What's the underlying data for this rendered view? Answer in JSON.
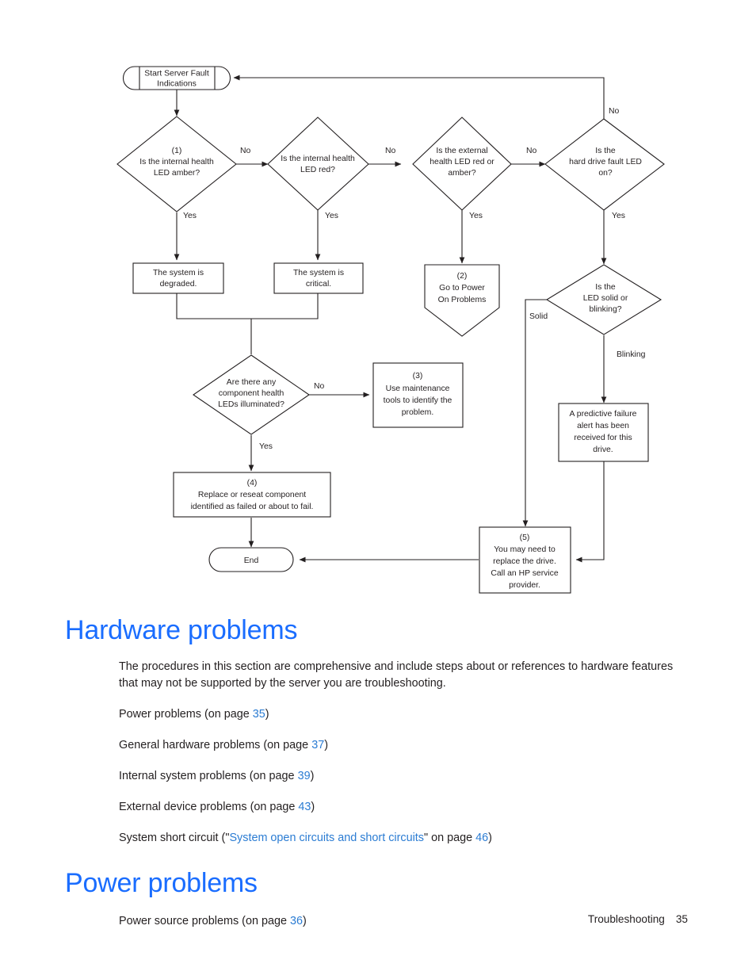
{
  "flowchart": {
    "title": "Server Fault Indications troubleshooting flowchart",
    "nodes": {
      "start": {
        "id": "start",
        "shape": "terminator",
        "text": [
          "Start Server Fault",
          "Indications"
        ]
      },
      "d1": {
        "id": "d1",
        "shape": "decision",
        "text": [
          "(1)",
          "Is the internal health",
          "LED amber?"
        ]
      },
      "d2": {
        "id": "d2",
        "shape": "decision",
        "text": [
          "Is the internal health",
          "LED red?"
        ]
      },
      "d3": {
        "id": "d3",
        "shape": "decision",
        "text": [
          "Is the external",
          "health LED red or",
          "amber?"
        ]
      },
      "d4": {
        "id": "d4",
        "shape": "decision",
        "text": [
          "Is the",
          "hard drive fault LED",
          "on?"
        ]
      },
      "d5": {
        "id": "d5",
        "shape": "decision",
        "text": [
          "Is the",
          "LED solid or",
          "blinking?"
        ]
      },
      "d6": {
        "id": "d6",
        "shape": "decision",
        "text": [
          "Are there any",
          "component health",
          "LEDs illuminated?"
        ]
      },
      "p1": {
        "id": "p1",
        "shape": "process",
        "text": [
          "The system is",
          "degraded."
        ]
      },
      "p2": {
        "id": "p2",
        "shape": "process",
        "text": [
          "The system is",
          "critical."
        ]
      },
      "p3": {
        "id": "p3",
        "shape": "pentagon",
        "text": [
          "(2)",
          "Go to Power",
          "On Problems"
        ]
      },
      "p4": {
        "id": "p4",
        "shape": "process",
        "text": [
          "(3)",
          "Use maintenance",
          "tools to identify the",
          "problem."
        ]
      },
      "p5": {
        "id": "p5",
        "shape": "process",
        "text": [
          "(4)",
          "Replace or reseat component",
          "identified as failed or about to fail."
        ]
      },
      "p6": {
        "id": "p6",
        "shape": "process",
        "text": [
          "A predictive failure",
          "alert has been",
          "received for this",
          "drive."
        ]
      },
      "p7": {
        "id": "p7",
        "shape": "process",
        "text": [
          "(5)",
          "You may need to",
          "replace the drive.",
          "Call an HP service",
          "provider."
        ]
      },
      "end": {
        "id": "end",
        "shape": "terminator",
        "text": [
          "End"
        ]
      }
    },
    "edge_labels": {
      "d1_no": "No",
      "d1_yes": "Yes",
      "d2_no": "No",
      "d2_yes": "Yes",
      "d3_no": "No",
      "d3_yes": "Yes",
      "d4_no": "No",
      "d4_yes": "Yes",
      "d5_solid": "Solid",
      "d5_blinking": "Blinking",
      "d6_no": "No",
      "d6_yes": "Yes"
    }
  },
  "content": {
    "hardware_heading": "Hardware problems",
    "intro_paragraph": "The procedures in this section are comprehensive and include steps about or references to hardware features that may not be supported by the server you are troubleshooting.",
    "xrefs": [
      {
        "label": "Power problems",
        "prefix": "Power problems (on page ",
        "page": "35",
        "suffix": ")"
      },
      {
        "label": "General hardware problems",
        "prefix": "General hardware problems (on page ",
        "page": "37",
        "suffix": ")"
      },
      {
        "label": "Internal system problems",
        "prefix": "Internal system problems (on page ",
        "page": "39",
        "suffix": ")"
      },
      {
        "label": "External device problems",
        "prefix": "External device problems (on page ",
        "page": "43",
        "suffix": ")"
      }
    ],
    "xref_short_circuit": {
      "prefix": "System short circuit (\"",
      "link": "System open circuits and short circuits",
      "middle": "\" on page ",
      "page": "46",
      "suffix": ")"
    },
    "power_heading": "Power problems",
    "power_xref": {
      "prefix": "Power source problems (on page ",
      "page": "36",
      "suffix": ")"
    }
  },
  "footer": {
    "chapter": "Troubleshooting",
    "page_number": "35"
  },
  "colors": {
    "heading_blue": "#1a6dff",
    "link_blue": "#2b7cd3",
    "text_black": "#231f20",
    "line_black": "#231f20",
    "page_white": "#ffffff"
  }
}
